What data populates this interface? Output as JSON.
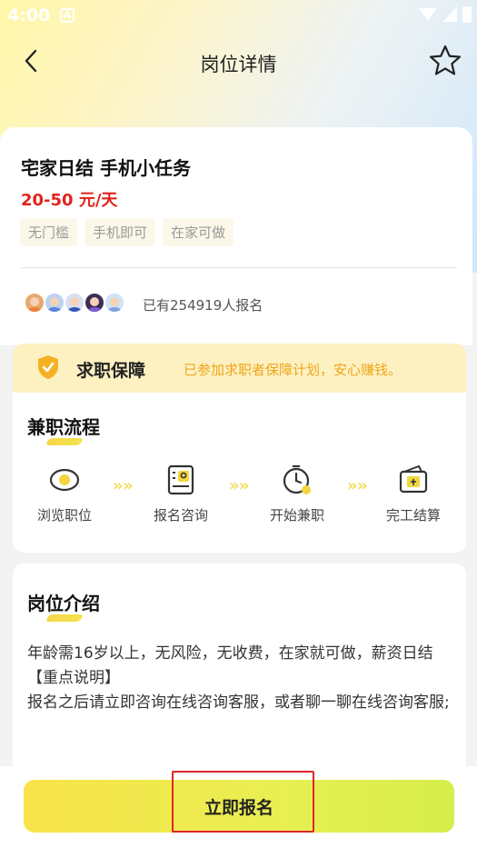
{
  "status_bar": {
    "time": "4:00",
    "notif": "A"
  },
  "nav": {
    "title": "岗位详情",
    "back_icon": "chevron-left-icon",
    "fav_icon": "star-outline-icon"
  },
  "job": {
    "title": "宅家日结 手机小任务",
    "salary": "20-50 元/天",
    "tags": [
      "无门槛",
      "手机即可",
      "在家可做"
    ],
    "signup_count": "已有254919人报名"
  },
  "guarantee": {
    "title": "求职保障",
    "text": "已参加求职者保障计划，安心赚钱。",
    "color": "#efa51b"
  },
  "process": {
    "title": "兼职流程",
    "steps": [
      {
        "label": "浏览职位",
        "icon": "eye-icon"
      },
      {
        "label": "报名咨询",
        "icon": "profile-card-icon"
      },
      {
        "label": "开始兼职",
        "icon": "clock-icon"
      },
      {
        "label": "完工结算",
        "icon": "wallet-icon"
      }
    ],
    "arrow": "»"
  },
  "intro": {
    "title": "岗位介绍",
    "line1": "年龄需16岁以上，无风险，无收费，在家就可做，薪资日结",
    "line2": "【重点说明】",
    "line3": "报名之后请立即咨询在线咨询客服，或者聊一聊在线咨询客服;"
  },
  "action": {
    "signup_label": "立即报名"
  },
  "colors": {
    "accent": "#f8e34a",
    "salary": "#e0241b",
    "highlight": "#e0242a"
  }
}
